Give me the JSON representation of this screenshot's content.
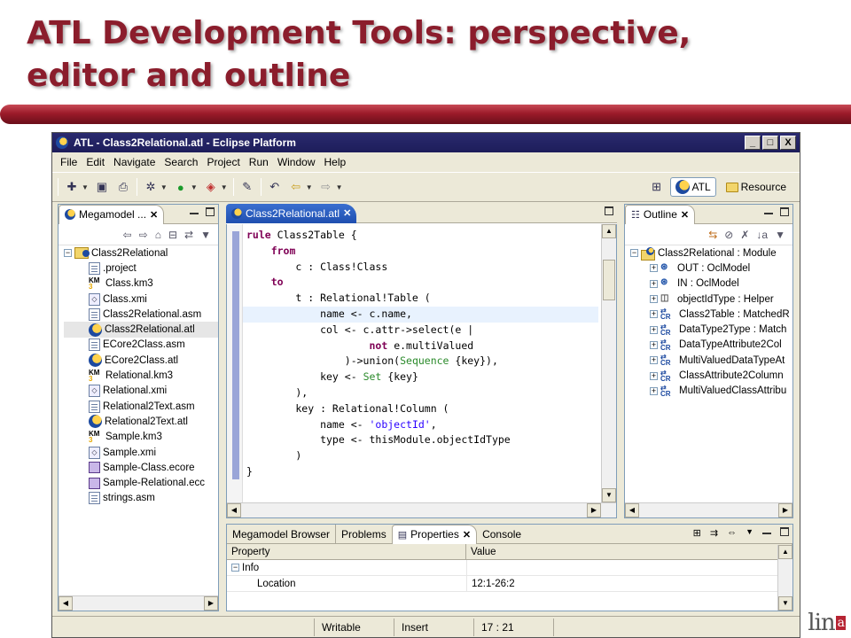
{
  "slide": {
    "title_line1": "ATL Development Tools: perspective,",
    "title_line2": "editor and outline",
    "logo_main": "lin",
    "logo_accent": "a"
  },
  "window": {
    "title": "ATL - Class2Relational.atl - Eclipse Platform",
    "btn_min": "_",
    "btn_max": "□",
    "btn_close": "X"
  },
  "menu": [
    "File",
    "Edit",
    "Navigate",
    "Search",
    "Project",
    "Run",
    "Window",
    "Help"
  ],
  "perspectives": {
    "atl": "ATL",
    "resource": "Resource"
  },
  "megamodel": {
    "tab_label": "Megamodel ...",
    "root": "Class2Relational",
    "items": [
      {
        "name": ".project",
        "icon": "file"
      },
      {
        "name": "Class.km3",
        "icon": "km3"
      },
      {
        "name": "Class.xmi",
        "icon": "xmi"
      },
      {
        "name": "Class2Relational.asm",
        "icon": "file"
      },
      {
        "name": "Class2Relational.atl",
        "icon": "atl"
      },
      {
        "name": "ECore2Class.asm",
        "icon": "file"
      },
      {
        "name": "ECore2Class.atl",
        "icon": "atl"
      },
      {
        "name": "Relational.km3",
        "icon": "km3"
      },
      {
        "name": "Relational.xmi",
        "icon": "xmi"
      },
      {
        "name": "Relational2Text.asm",
        "icon": "file"
      },
      {
        "name": "Relational2Text.atl",
        "icon": "atl"
      },
      {
        "name": "Sample.km3",
        "icon": "km3"
      },
      {
        "name": "Sample.xmi",
        "icon": "xmi"
      },
      {
        "name": "Sample-Class.ecore",
        "icon": "ecore"
      },
      {
        "name": "Sample-Relational.ecc",
        "icon": "ecore"
      },
      {
        "name": "strings.asm",
        "icon": "file"
      }
    ]
  },
  "editor": {
    "tab_label": "Class2Relational.atl",
    "lines": [
      [
        [
          "kw",
          "rule"
        ],
        [
          "t",
          " Class2Table {"
        ]
      ],
      [
        [
          "t",
          "    "
        ],
        [
          "kw",
          "from"
        ]
      ],
      [
        [
          "t",
          "        c : Class!Class"
        ]
      ],
      [
        [
          "t",
          "    "
        ],
        [
          "kw",
          "to"
        ]
      ],
      [
        [
          "t",
          "        t : Relational!Table ("
        ]
      ],
      [
        [
          "t",
          "            name <- c.name,"
        ]
      ],
      [
        [
          "t",
          "            col <- c.attr->select(e |"
        ]
      ],
      [
        [
          "t",
          "                    "
        ],
        [
          "kw",
          "not"
        ],
        [
          "t",
          " e.multiValued"
        ]
      ],
      [
        [
          "t",
          "                )->union("
        ],
        [
          "kw2",
          "Sequence"
        ],
        [
          "t",
          " {key}),"
        ]
      ],
      [
        [
          "t",
          "            key <- "
        ],
        [
          "kw2",
          "Set"
        ],
        [
          "t",
          " {key}"
        ]
      ],
      [
        [
          "t",
          "        ),"
        ]
      ],
      [
        [
          "t",
          "        key : Relational!Column ("
        ]
      ],
      [
        [
          "t",
          "            name <- "
        ],
        [
          "str",
          "'objectId'"
        ],
        [
          "t",
          ","
        ]
      ],
      [
        [
          "t",
          "            type <- thisModule.objectIdType"
        ]
      ],
      [
        [
          "t",
          "        )"
        ]
      ],
      [
        [
          "t",
          "}"
        ]
      ]
    ]
  },
  "outline": {
    "tab_label": "Outline",
    "root": "Class2Relational : Module",
    "items": [
      {
        "name": "OUT : OclModel",
        "icon": "model"
      },
      {
        "name": "IN : OclModel",
        "icon": "model"
      },
      {
        "name": "objectIdType : Helper",
        "icon": "helper"
      },
      {
        "name": "Class2Table : MatchedR",
        "icon": "rule"
      },
      {
        "name": "DataType2Type : Match",
        "icon": "rule"
      },
      {
        "name": "DataTypeAttribute2Col",
        "icon": "rule"
      },
      {
        "name": "MultiValuedDataTypeAt",
        "icon": "rule"
      },
      {
        "name": "ClassAttribute2Column",
        "icon": "rule"
      },
      {
        "name": "MultiValuedClassAttribu",
        "icon": "rule"
      }
    ]
  },
  "bottom": {
    "tabs": [
      "Megamodel Browser",
      "Problems",
      "Properties",
      "Console"
    ],
    "headers": [
      "Property",
      "Value"
    ],
    "rows": [
      {
        "property": "Info",
        "value": "",
        "group": true
      },
      {
        "property": "Location",
        "value": "12:1-26:2",
        "group": false
      }
    ]
  },
  "status": {
    "writable": "Writable",
    "insert": "Insert",
    "position": "17 : 21"
  },
  "colors": {
    "accent": "#8b1d2c",
    "keyword": "#7f0055",
    "editor_tab": "#1f4fb0"
  }
}
